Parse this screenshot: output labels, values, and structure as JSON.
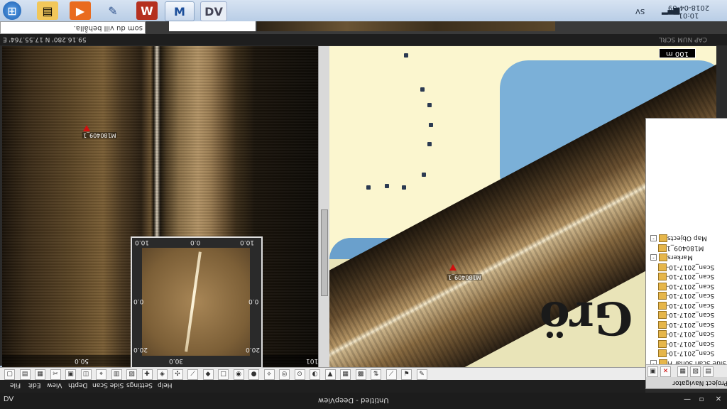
{
  "taskbar": {
    "clock_time": "10:01",
    "clock_date": "2018-04-09",
    "language": "SV",
    "apps": [
      "start-orb",
      "file-explorer",
      "media-player",
      "tools-app",
      "wing-app",
      "map-app",
      "deepvision-app"
    ]
  },
  "search": {
    "text": "som du vill behålla."
  },
  "status": {
    "coordinates": "59.16.280' N 17.55.764' E",
    "indicators": "CAP NUM SCRL"
  },
  "left_panel": {
    "marker_label": "M180409_1",
    "axis_left": "50.0",
    "axis_right": "101"
  },
  "inset": {
    "top_left": "10.0",
    "top_mid": "0.0",
    "top_right": "10.0",
    "left_mid": "0.0",
    "right_mid": "0.0",
    "bottom_left": "20.0",
    "bottom_mid": "30.0",
    "bottom_right": "20.0"
  },
  "map": {
    "scale_label": "100 m",
    "marker_label": "M180409_1",
    "place_text": "Grö"
  },
  "navigator": {
    "title": "Project Navigator",
    "rows": [
      {
        "indent": 0,
        "box": "-",
        "label": "Map Objects"
      },
      {
        "indent": 1,
        "box": "",
        "label": "M180409_1"
      },
      {
        "indent": 0,
        "box": "-",
        "label": "Markers"
      },
      {
        "indent": 1,
        "box": "",
        "label": "Scan_2017-10-"
      },
      {
        "indent": 1,
        "box": "",
        "label": "Scan_2017-10-"
      },
      {
        "indent": 1,
        "box": "",
        "label": "Scan_2017-10-"
      },
      {
        "indent": 1,
        "box": "",
        "label": "Scan_2017-10-"
      },
      {
        "indent": 1,
        "box": "",
        "label": "Scan_2017-10-"
      },
      {
        "indent": 1,
        "box": "",
        "label": "Scan_2017-10-"
      },
      {
        "indent": 1,
        "box": "",
        "label": "Scan_2017-10-"
      },
      {
        "indent": 1,
        "box": "",
        "label": "Scan_2017-10-"
      },
      {
        "indent": 1,
        "box": "",
        "label": "Scan_2017-10-"
      },
      {
        "indent": 1,
        "box": "",
        "label": "Scan_2017-10-"
      },
      {
        "indent": 0,
        "box": "-",
        "label": "Side Scan Sonar Fi"
      }
    ]
  },
  "menu": [
    "File",
    "Edit",
    "View",
    "Depth",
    "Side Scan",
    "Settings",
    "Help"
  ],
  "window": {
    "title": "Untitled - DeepView"
  }
}
